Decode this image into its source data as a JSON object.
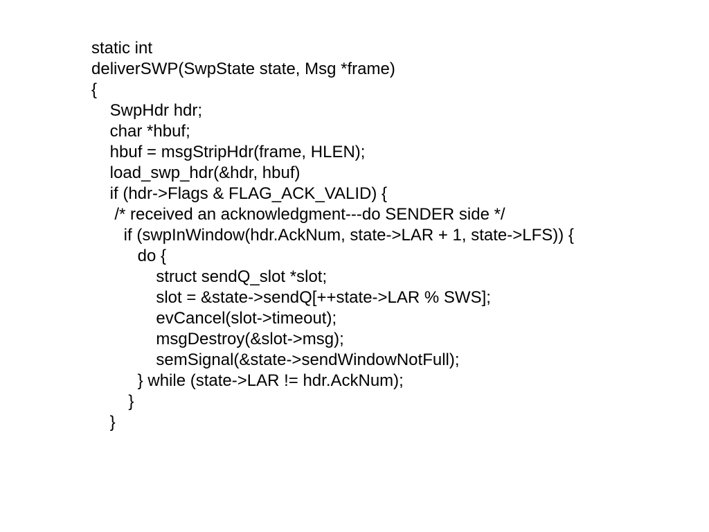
{
  "code": {
    "lines": [
      "static int",
      "deliverSWP(SwpState state, Msg *frame)",
      "{",
      "    SwpHdr hdr;",
      "    char *hbuf;",
      "    hbuf = msgStripHdr(frame, HLEN);",
      "    load_swp_hdr(&hdr, hbuf)",
      "    if (hdr->Flags & FLAG_ACK_VALID) {",
      "     /* received an acknowledgment---do SENDER side */",
      "       if (swpInWindow(hdr.AckNum, state->LAR + 1, state->LFS)) {",
      "          do {",
      "              struct sendQ_slot *slot;",
      "              slot = &state->sendQ[++state->LAR % SWS];",
      "              evCancel(slot->timeout);",
      "              msgDestroy(&slot->msg);",
      "              semSignal(&state->sendWindowNotFull);",
      "          } while (state->LAR != hdr.AckNum);",
      "        }",
      "    }"
    ]
  }
}
